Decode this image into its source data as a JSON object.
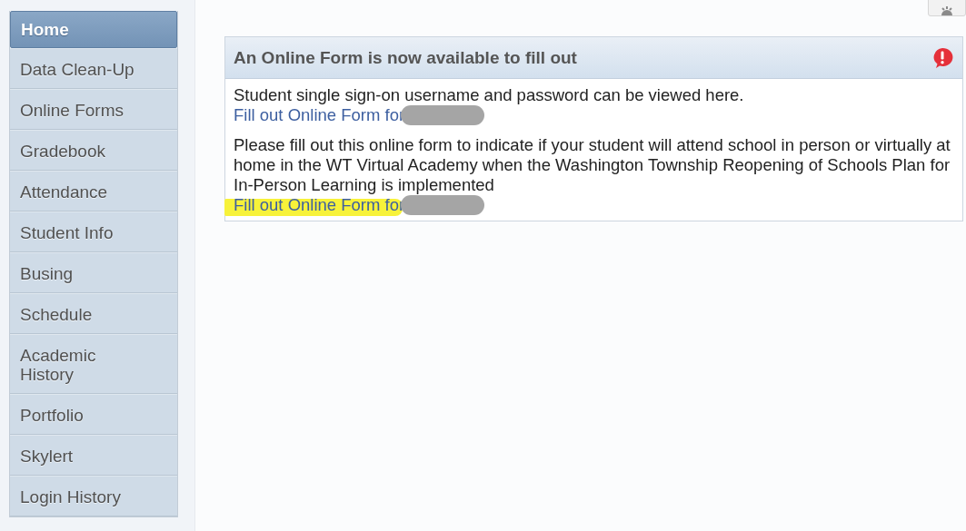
{
  "sidebar": {
    "items": [
      {
        "label": "Home",
        "selected": true
      },
      {
        "label": "Data Clean-Up",
        "selected": false
      },
      {
        "label": "Online Forms",
        "selected": false
      },
      {
        "label": "Gradebook",
        "selected": false
      },
      {
        "label": "Attendance",
        "selected": false
      },
      {
        "label": "Student Info",
        "selected": false
      },
      {
        "label": "Busing",
        "selected": false
      },
      {
        "label": "Schedule",
        "selected": false
      },
      {
        "label": "Academic History",
        "selected": false
      },
      {
        "label": "Portfolio",
        "selected": false
      },
      {
        "label": "Skylert",
        "selected": false
      },
      {
        "label": "Login History",
        "selected": false
      }
    ]
  },
  "notice": {
    "title": "An Online Form is now available to fill out",
    "entries": [
      {
        "text": "Student single sign-on username and password can be viewed here.",
        "link": "Fill out Online Form for",
        "highlighted": false
      },
      {
        "text": "Please fill out this online form to indicate if your student will attend school in person or virtually at home in the WT Virtual Academy when the Washington Township Reopening of Schools Plan for In-Person Learning is implemented",
        "link": "Fill out Online Form for",
        "highlighted": true
      }
    ]
  }
}
